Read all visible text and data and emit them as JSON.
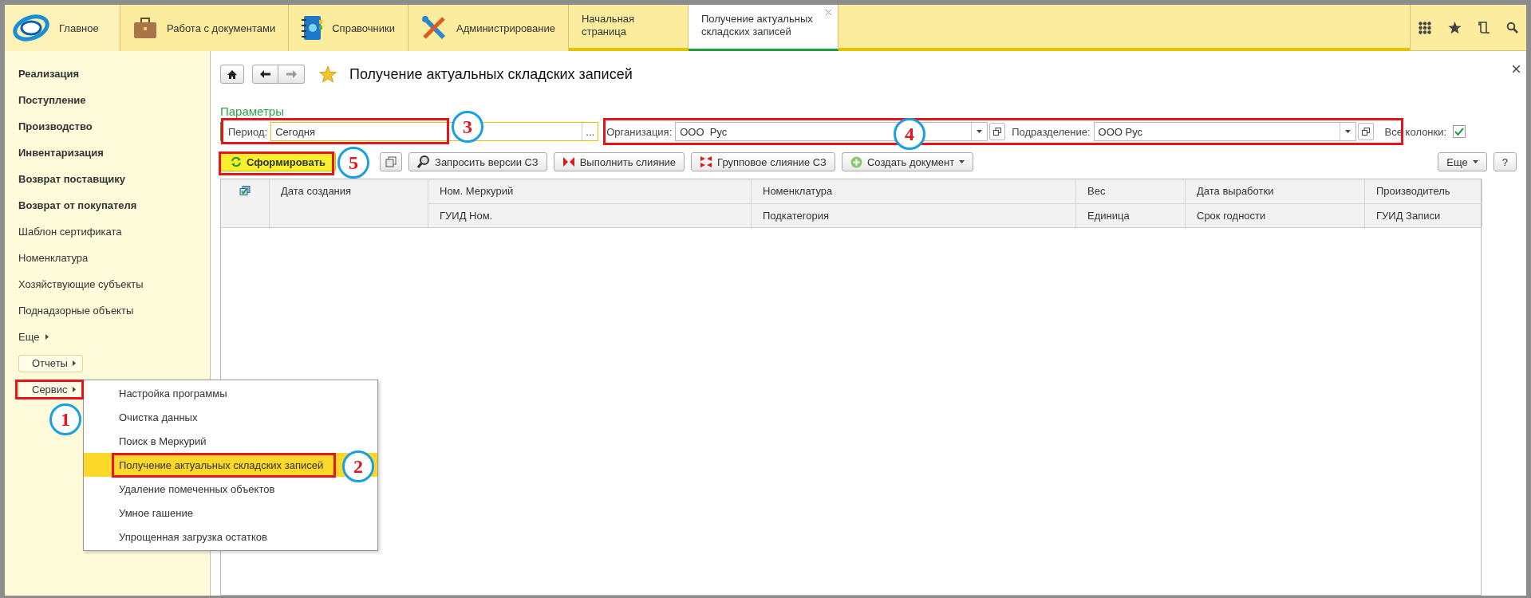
{
  "sections": [
    {
      "label": "Главное",
      "kind": "logo",
      "selected": true
    },
    {
      "label": "Работа с документами",
      "kind": "briefcase",
      "selected": false
    },
    {
      "label": "Справочники",
      "kind": "notebook",
      "selected": false
    },
    {
      "label": "Администрирование",
      "kind": "tools",
      "selected": false
    }
  ],
  "open_tabs": [
    {
      "label": "Начальная страница",
      "selected": false,
      "closable": false
    },
    {
      "label": "Получение актуальных складских записей",
      "selected": true,
      "closable": true
    }
  ],
  "sidebar": {
    "items": [
      {
        "label": "Реализация",
        "kind": "section"
      },
      {
        "label": "Поступление",
        "kind": "section"
      },
      {
        "label": "Производство",
        "kind": "section"
      },
      {
        "label": "Инвентаризация",
        "kind": "section"
      },
      {
        "label": "Возврат поставщику",
        "kind": "section"
      },
      {
        "label": "Возврат от покупателя",
        "kind": "section"
      },
      {
        "label": "Шаблон сертификата",
        "kind": "link"
      },
      {
        "label": "Номенклатура",
        "kind": "link"
      },
      {
        "label": "Хозяйствующие субъекты",
        "kind": "link"
      },
      {
        "label": "Поднадзорные объекты",
        "kind": "link"
      },
      {
        "label": "Еще",
        "kind": "more"
      },
      {
        "label": "Отчеты",
        "kind": "button"
      },
      {
        "label": "Сервис",
        "kind": "button"
      }
    ]
  },
  "menu": {
    "items": [
      {
        "label": "Настройка программы",
        "selected": false
      },
      {
        "label": "Очистка данных",
        "selected": false
      },
      {
        "label": "Поиск в Меркурий",
        "selected": false
      },
      {
        "label": "Получение актуальных складских записей",
        "selected": true
      },
      {
        "label": "Удаление помеченных объектов",
        "selected": false
      },
      {
        "label": "Умное гашение",
        "selected": false
      },
      {
        "label": "Упрощенная загрузка остатков",
        "selected": false
      }
    ]
  },
  "page": {
    "title": "Получение актуальных складских записей",
    "params_label": "Параметры",
    "period": {
      "label": "Период:",
      "value": "Сегодня",
      "button": "..."
    },
    "organization": {
      "label": "Организация:",
      "value": "ООО  Рус"
    },
    "division": {
      "label": "Подразделение:",
      "value": "ООО Рус"
    },
    "all_columns": {
      "label": "Все колонки:",
      "checked": true
    }
  },
  "toolbar": {
    "buttons": [
      {
        "label": "Сформировать",
        "kind": "refresh"
      },
      {
        "kind": "copy"
      },
      {
        "label": "Запросить версии СЗ",
        "kind": "request"
      },
      {
        "label": "Выполнить слияние",
        "kind": "merge"
      },
      {
        "label": "Групповое слияние СЗ",
        "kind": "group-merge"
      },
      {
        "label": "Создать документ",
        "kind": "create",
        "dropdown": true
      }
    ],
    "right": [
      {
        "label": "Еще",
        "dropdown": true
      },
      {
        "label": "?",
        "dropdown": false
      }
    ]
  },
  "table": {
    "columns": [
      {
        "top": "Дата создания"
      },
      {
        "top": "Ном. Меркурий",
        "bottom": "ГУИД Ном."
      },
      {
        "top": "Номенклатура",
        "bottom": "Подкатегория"
      },
      {
        "top": "Вес",
        "bottom": "Единица"
      },
      {
        "top": "Дата выработки",
        "bottom": "Срок годности"
      },
      {
        "top": "Производитель",
        "bottom": "ГУИД Записи"
      }
    ]
  },
  "annotations": [
    {
      "number": "1"
    },
    {
      "number": "2"
    },
    {
      "number": "3"
    },
    {
      "number": "4"
    },
    {
      "number": "5"
    }
  ]
}
